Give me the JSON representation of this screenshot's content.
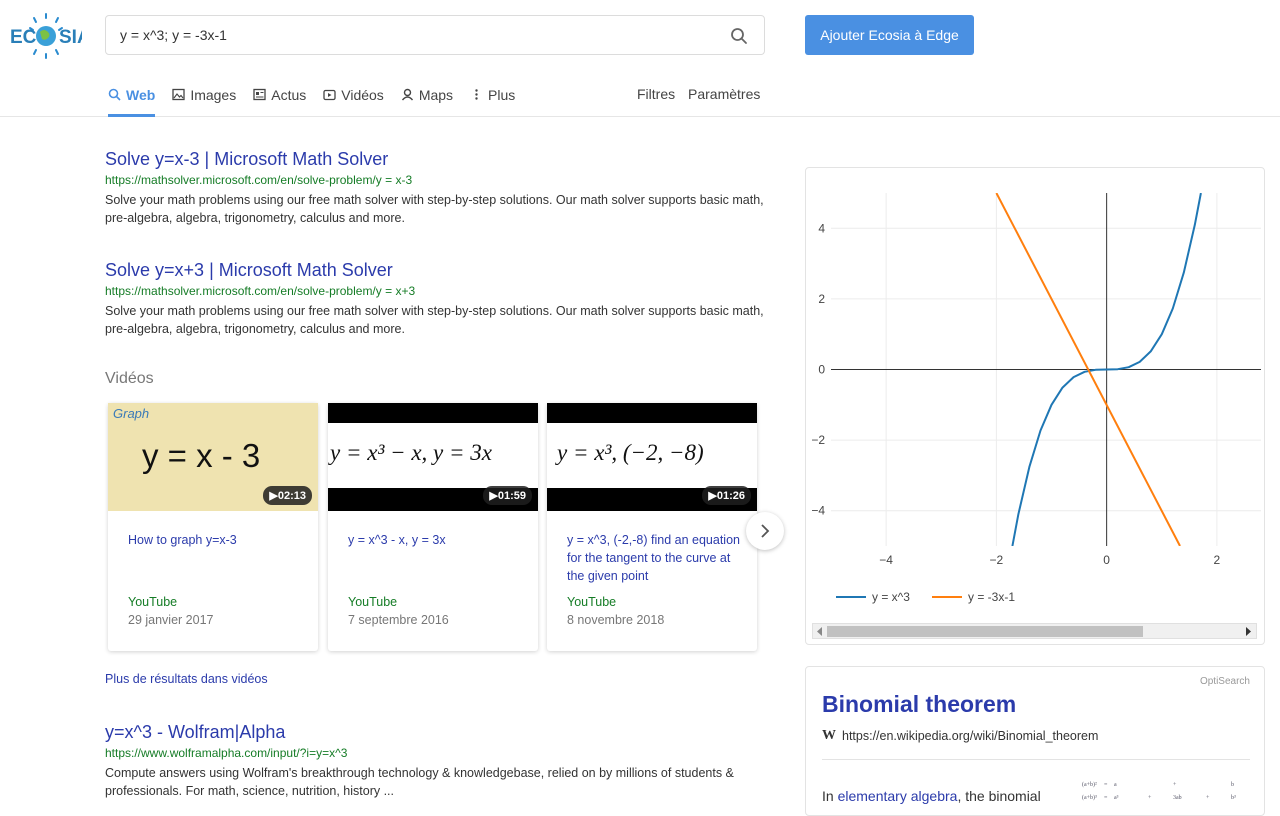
{
  "app": {
    "logo_text": "ECOSIA"
  },
  "search": {
    "query": "y = x^3; y = -3x-1",
    "placeholder": ""
  },
  "header": {
    "add_button": "Ajouter Ecosia à Edge"
  },
  "tabs": [
    {
      "label": "Web",
      "icon": "search-icon",
      "active": true
    },
    {
      "label": "Images",
      "icon": "image-icon"
    },
    {
      "label": "Actus",
      "icon": "news-icon"
    },
    {
      "label": "Vidéos",
      "icon": "video-icon"
    },
    {
      "label": "Maps",
      "icon": "map-pin-icon"
    },
    {
      "label": "Plus",
      "icon": "more-vertical-icon"
    }
  ],
  "right_tabs": {
    "filters": "Filtres",
    "settings": "Paramètres"
  },
  "results": [
    {
      "title": "Solve y=x-3 | Microsoft Math Solver",
      "url": "https://mathsolver.microsoft.com/en/solve-problem/y = x-3",
      "snippet": "Solve your math problems using our free math solver with step-by-step solutions. Our math solver supports basic math, pre-algebra, algebra, trigonometry, calculus and more."
    },
    {
      "title": "Solve y=x+3 | Microsoft Math Solver",
      "url": "https://mathsolver.microsoft.com/en/solve-problem/y = x+3",
      "snippet": "Solve your math problems using our free math solver with step-by-step solutions. Our math solver supports basic math, pre-algebra, algebra, trigonometry, calculus and more."
    },
    {
      "title": "y=x^3 - Wolfram|Alpha",
      "url": "https://www.wolframalpha.com/input/?i=y=x^3",
      "snippet": "Compute answers using Wolfram's breakthrough technology & knowledgebase, relied on by millions of students & professionals. For math, science, nutrition, history ..."
    }
  ],
  "videos": {
    "section_label": "Vidéos",
    "more_link": "Plus de résultats dans vidéos",
    "items": [
      {
        "thumb_caption": "Graph",
        "thumb_text": "y = x - 3",
        "duration": "02:13",
        "title": "How to graph y=x-3",
        "source": "YouTube",
        "date": "29 janvier 2017"
      },
      {
        "thumb_text": "y = x³ − x,   y = 3x",
        "duration": "01:59",
        "title": "y = x^3 - x, y = 3x",
        "source": "YouTube",
        "date": "7 septembre 2016"
      },
      {
        "thumb_text": "y = x³,   (−2, −8)",
        "duration": "01:26",
        "title": "y = x^3, (-2,-8) find an equation for the tangent to the curve at the given point",
        "source": "YouTube",
        "date": "8 novembre 2018"
      }
    ]
  },
  "chart_data": {
    "type": "line",
    "title": "",
    "xlim": [
      -5.0,
      2.8
    ],
    "ylim": [
      -5.0,
      5.0
    ],
    "x_ticks": [
      -4,
      -2,
      0,
      2
    ],
    "y_ticks": [
      -4,
      -2,
      0,
      2,
      4
    ],
    "x_tick_labels": [
      "−4",
      "−2",
      "0",
      "2"
    ],
    "y_tick_labels": [
      "−4",
      "−2",
      "0",
      "2",
      "4"
    ],
    "grid": true,
    "legend_position": "bottom",
    "series": [
      {
        "name": "y = x^3",
        "color": "#1f77b4",
        "x": [
          -1.71,
          -1.6,
          -1.4,
          -1.2,
          -1.0,
          -0.8,
          -0.6,
          -0.4,
          -0.2,
          0,
          0.2,
          0.4,
          0.6,
          0.8,
          1.0,
          1.2,
          1.4,
          1.6,
          1.71
        ],
        "y": [
          -5.0,
          -4.096,
          -2.744,
          -1.728,
          -1.0,
          -0.512,
          -0.216,
          -0.064,
          -0.008,
          0,
          0.008,
          0.064,
          0.216,
          0.512,
          1.0,
          1.728,
          2.744,
          4.096,
          5.0
        ]
      },
      {
        "name": "y = -3x-1",
        "color": "#ff7f0e",
        "x": [
          -2.0,
          1.33
        ],
        "y": [
          5.0,
          -5.0
        ]
      }
    ]
  },
  "knowledge": {
    "badge": "OptiSearch",
    "title": "Binomial theorem",
    "wiki_symbol": "W",
    "wiki_url": "https://en.wikipedia.org/wiki/Binomial_theorem",
    "snippet_start": "In",
    "snippet_link": "elementary algebra",
    "snippet_rest": ", the binomial"
  }
}
